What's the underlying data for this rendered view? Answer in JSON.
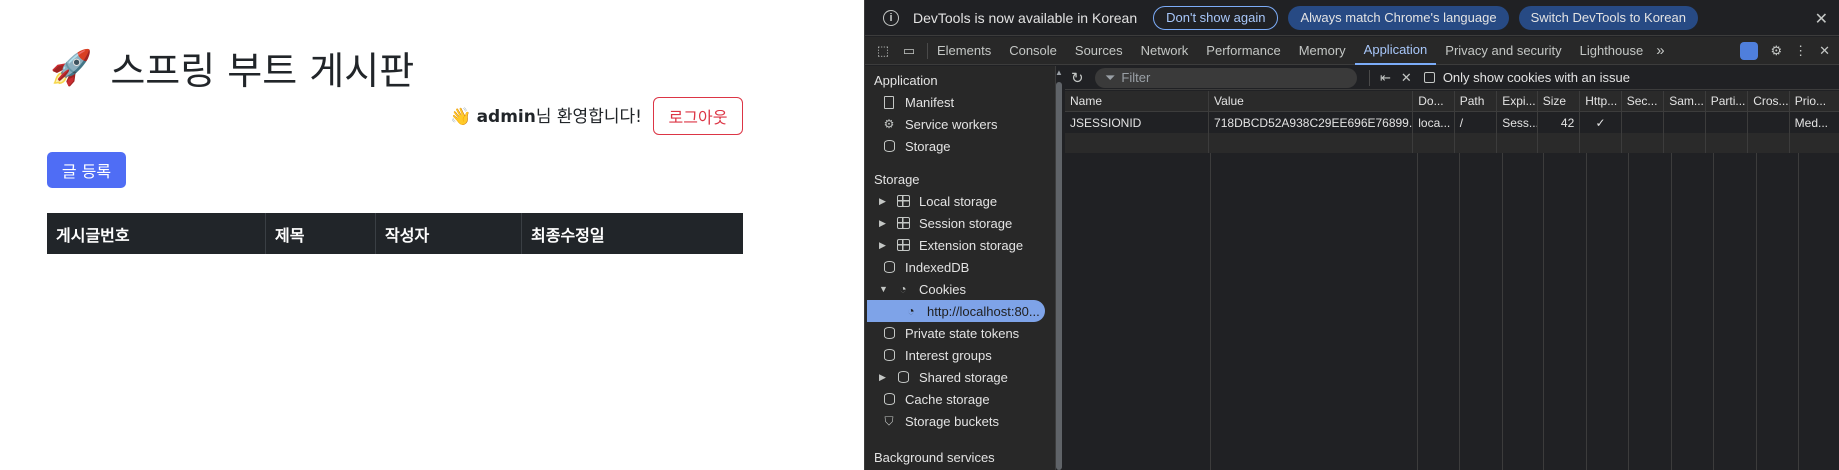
{
  "page": {
    "title_icon": "rocket-emoji",
    "title": "스프링 부트 게시판",
    "welcome_icon": "waving-hand-emoji",
    "username": "admin",
    "welcome_suffix": "님 환영합니다!",
    "logout_label": "로그아웃",
    "write_label": "글 등록",
    "table_headers": [
      "게시글번호",
      "제목",
      "작성자",
      "최종수정일"
    ]
  },
  "devtools": {
    "infobar": {
      "message": "DevTools is now available in Korean",
      "dont_show": "Don't show again",
      "always_match": "Always match Chrome's language",
      "switch": "Switch DevTools to Korean"
    },
    "tabs": [
      "Elements",
      "Console",
      "Sources",
      "Network",
      "Performance",
      "Memory",
      "Application",
      "Privacy and security",
      "Lighthouse"
    ],
    "active_tab": "Application",
    "sidebar": {
      "application_section": "Application",
      "application_items": [
        "Manifest",
        "Service workers",
        "Storage"
      ],
      "storage_section": "Storage",
      "storage_items": [
        "Local storage",
        "Session storage",
        "Extension storage",
        "IndexedDB",
        "Cookies",
        "http://localhost:80...",
        "Private state tokens",
        "Interest groups",
        "Shared storage",
        "Cache storage",
        "Storage buckets"
      ],
      "background_section": "Background services"
    },
    "filter": {
      "placeholder": "Filter",
      "only_issues_label": "Only show cookies with an issue"
    },
    "cookie_table": {
      "headers": [
        "Name",
        "Value",
        "Do...",
        "Path",
        "Expi...",
        "Size",
        "Http...",
        "Sec...",
        "Sam...",
        "Parti...",
        "Cros...",
        "Prio..."
      ],
      "rows": [
        [
          "JSESSIONID",
          "718DBCD52A938C29EE696E76899...",
          "loca...",
          "/",
          "Sess...",
          "42",
          "✓",
          "",
          "",
          "",
          "",
          "Med..."
        ]
      ]
    }
  }
}
